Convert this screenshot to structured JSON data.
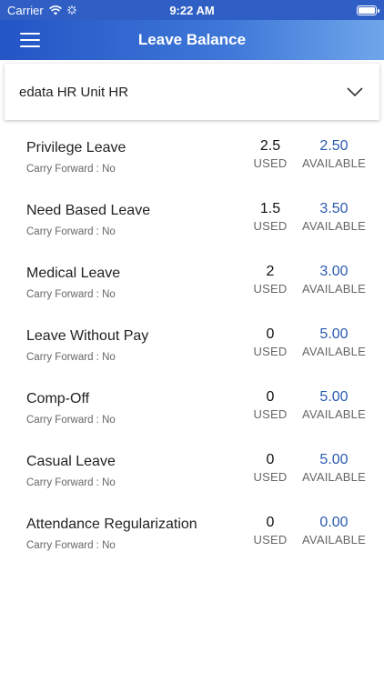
{
  "status_bar": {
    "carrier": "Carrier",
    "time": "9:22 AM"
  },
  "nav": {
    "title": "Leave Balance"
  },
  "unit_select": {
    "value": "edata HR Unit HR"
  },
  "captions": {
    "used": "USED",
    "available": "AVAILABLE"
  },
  "leaves": [
    {
      "name": "Privilege Leave",
      "carry_forward": "Carry Forward : No",
      "used": "2.5",
      "available": "2.50"
    },
    {
      "name": "Need Based Leave",
      "carry_forward": "Carry Forward : No",
      "used": "1.5",
      "available": "3.50"
    },
    {
      "name": "Medical Leave",
      "carry_forward": "Carry Forward : No",
      "used": "2",
      "available": "3.00"
    },
    {
      "name": "Leave Without Pay",
      "carry_forward": "Carry Forward : No",
      "used": "0",
      "available": "5.00"
    },
    {
      "name": "Comp-Off",
      "carry_forward": "Carry Forward : No",
      "used": "0",
      "available": "5.00"
    },
    {
      "name": "Casual Leave",
      "carry_forward": "Carry Forward : No",
      "used": "0",
      "available": "5.00"
    },
    {
      "name": "Attendance Regularization",
      "carry_forward": "Carry Forward : No",
      "used": "0",
      "available": "0.00"
    }
  ]
}
